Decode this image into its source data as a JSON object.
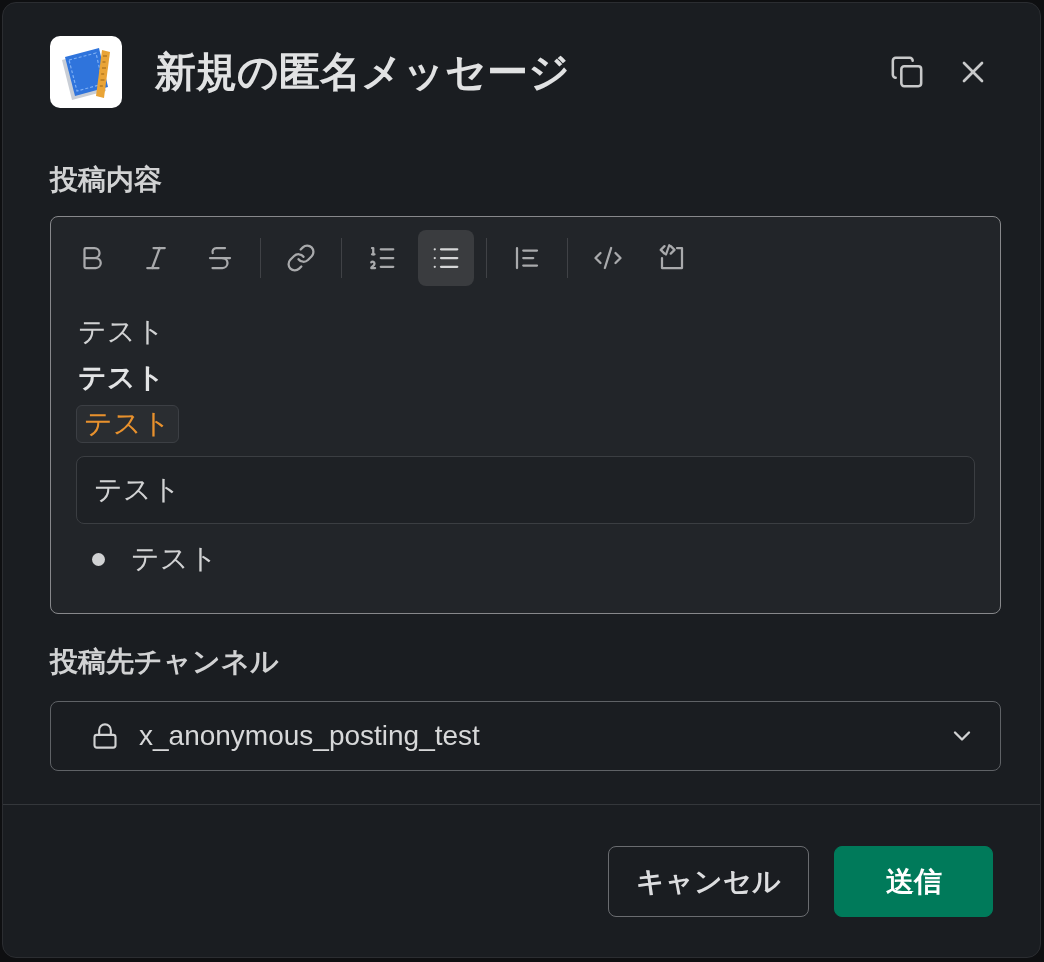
{
  "dialog": {
    "title": "新規の匿名メッセージ"
  },
  "message_field": {
    "label": "投稿内容",
    "toolbar": [
      [
        {
          "kind": "bold",
          "active": false
        },
        {
          "kind": "italic",
          "active": false
        },
        {
          "kind": "strike",
          "active": false
        }
      ],
      [
        {
          "kind": "link",
          "active": false
        }
      ],
      [
        {
          "kind": "numbered",
          "active": false
        },
        {
          "kind": "bulleted",
          "active": true
        }
      ],
      [
        {
          "kind": "quote",
          "active": false
        }
      ],
      [
        {
          "kind": "code",
          "active": false
        },
        {
          "kind": "codeblock",
          "active": false
        }
      ]
    ],
    "content": [
      {
        "kind": "plain",
        "text": "テスト"
      },
      {
        "kind": "bold",
        "text": "テスト"
      },
      {
        "kind": "code",
        "text": "テスト"
      },
      {
        "kind": "codeblock",
        "text": "テスト"
      },
      {
        "kind": "bullet",
        "text": "テスト"
      }
    ]
  },
  "channel_field": {
    "label": "投稿先チャンネル",
    "value": "x_anonymous_posting_test",
    "private": true
  },
  "buttons": [
    {
      "kind": "secondary",
      "label": "キャンセル"
    },
    {
      "kind": "primary",
      "label": "送信"
    }
  ]
}
